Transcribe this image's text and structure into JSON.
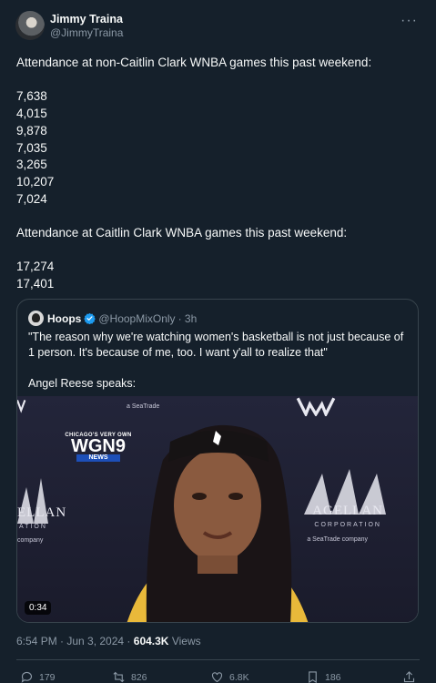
{
  "author": {
    "display_name": "Jimmy Traina",
    "handle": "@JimmyTraina"
  },
  "more_menu_icon": "more-horizontal-icon",
  "tweet": {
    "line1": "Attendance at non-Caitlin Clark WNBA games this past weekend:",
    "non_clark_attendance": [
      "7,638",
      "4,015",
      "9,878",
      "7,035",
      "3,265",
      "10,207",
      "7,024"
    ],
    "line2": "Attendance at Caitlin Clark WNBA games this past weekend:",
    "clark_attendance": [
      "17,274",
      "17,401"
    ]
  },
  "quoted": {
    "display_name": "Hoops",
    "verified": true,
    "handle": "@HoopMixOnly",
    "time": "· 3h",
    "text": "\"The reason why we're watching women's basketball is not just because of 1 person. It's because of me, too. I want y'all to realize that\"",
    "text2": "Angel Reese speaks:",
    "video": {
      "duration": "0:34",
      "overlay_top": "CHICAGO'S VERY OWN",
      "overlay_main": "WGN9",
      "overlay_news": "NEWS",
      "sponsor_left": "ELLAN",
      "sponsor_left_sub": "ATION",
      "sponsor_left_small": "company",
      "sponsor_right": "AGELLAN",
      "sponsor_right_sub": "CORPORATION",
      "sponsor_right_small": "a SeaTrade company",
      "sponsor_top": "a SeaTrade"
    }
  },
  "meta": {
    "timestamp": "6:54 PM · Jun 3, 2024",
    "dot": "·",
    "views_count": "604.3K",
    "views_label": "Views"
  },
  "actions": {
    "replies": "179",
    "retweets": "826",
    "likes": "6.8K",
    "bookmarks": "186"
  },
  "colors": {
    "background": "#15202b",
    "text": "#f7f9f9",
    "secondary": "#8b98a5",
    "border": "#38444d",
    "verified": "#1d9bf0"
  }
}
